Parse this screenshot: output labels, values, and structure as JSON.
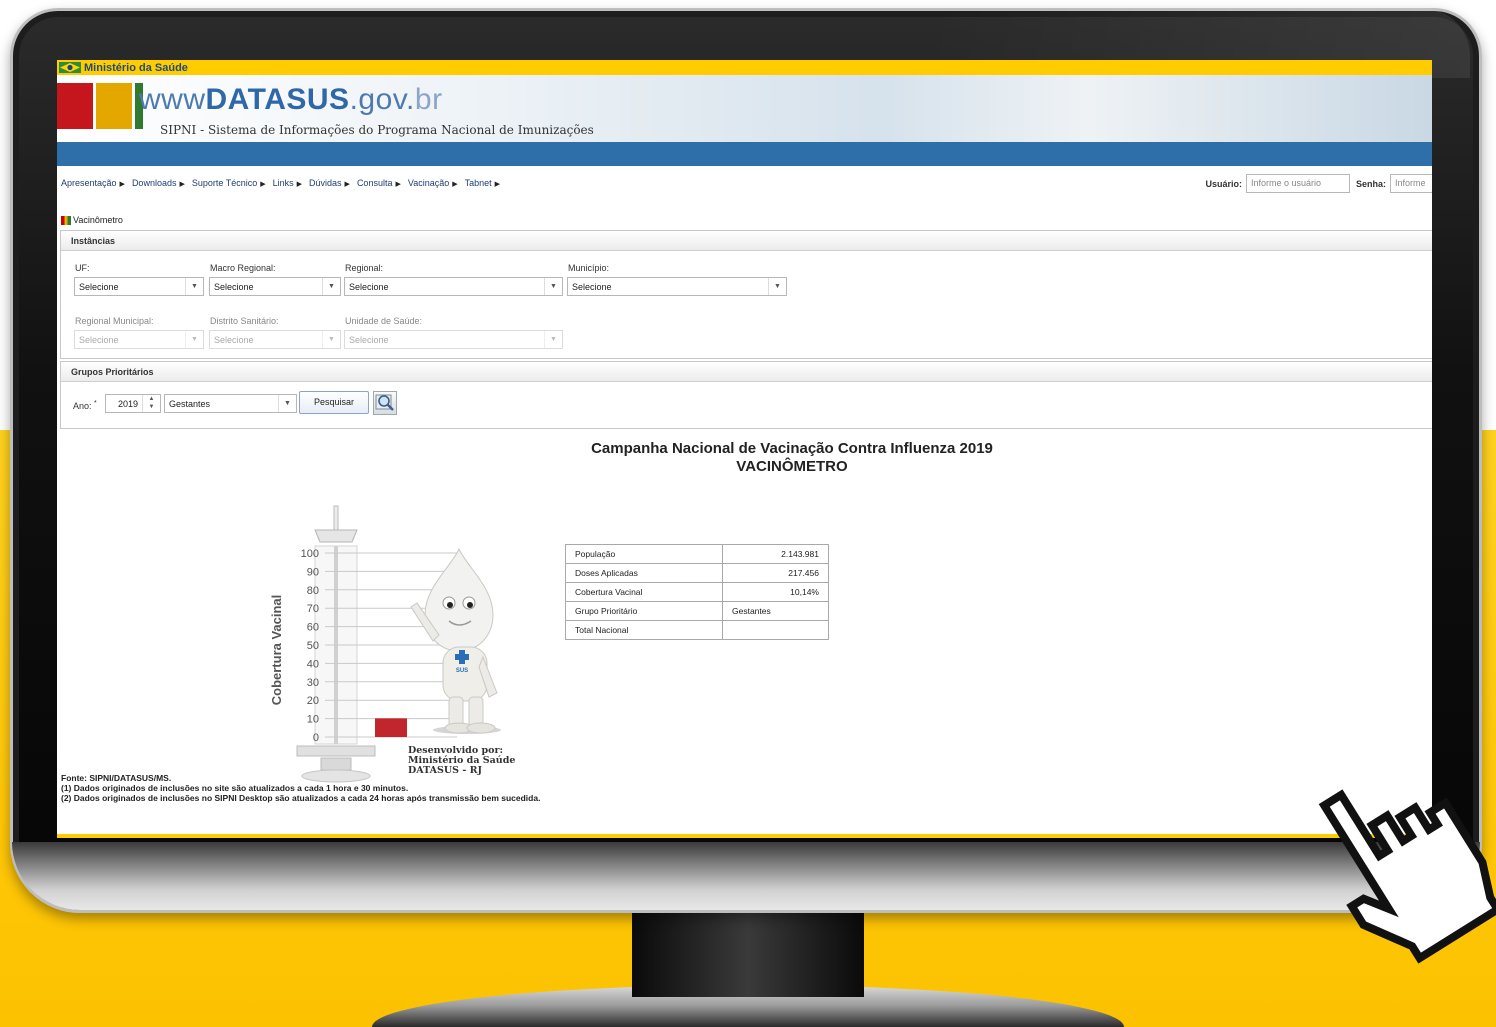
{
  "top_bar": {
    "ministry": "Ministério da Saúde"
  },
  "banner": {
    "site_prefix": "ww",
    "site_w": "w",
    "site_name": "DATASUS",
    "site_suffix": ".gov.",
    "site_tld": "br",
    "subtitle": "SIPNI - Sistema de Informações do Programa Nacional de Imunizações"
  },
  "nav": {
    "items": [
      {
        "label": "Apresentação"
      },
      {
        "label": "Downloads"
      },
      {
        "label": "Suporte Técnico"
      },
      {
        "label": "Links"
      },
      {
        "label": "Dúvidas"
      },
      {
        "label": "Consulta"
      },
      {
        "label": "Vacinação"
      },
      {
        "label": "Tabnet"
      }
    ],
    "arrow": "▶"
  },
  "login": {
    "user_label": "Usuário:",
    "user_placeholder": "Informe o usuário",
    "pass_label": "Senha:",
    "pass_placeholder": "Informe"
  },
  "breadcrumb": {
    "label": "Vacinômetro"
  },
  "instancias": {
    "heading": "Instâncias",
    "fields": [
      {
        "label": "UF:",
        "value": "Selecione",
        "enabled": true
      },
      {
        "label": "Macro Regional:",
        "value": "Selecione",
        "enabled": true
      },
      {
        "label": "Regional:",
        "value": "Selecione",
        "enabled": true
      },
      {
        "label": "Município:",
        "value": "Selecione",
        "enabled": true
      },
      {
        "label": "Regional Municipal:",
        "value": "Selecione",
        "enabled": false
      },
      {
        "label": "Distrito Sanitário:",
        "value": "Selecione",
        "enabled": false
      },
      {
        "label": "Unidade de Saúde:",
        "value": "Selecione",
        "enabled": false
      }
    ]
  },
  "grupos": {
    "heading": "Grupos Prioritários",
    "ano_label": "Ano:",
    "required_mark": "*",
    "ano_value": "2019",
    "grupo_value": "Gestantes",
    "search_label": "Pesquisar"
  },
  "report": {
    "title": "Campanha Nacional de Vacinação Contra Influenza 2019",
    "subtitle": "VACINÔMETRO",
    "rows": [
      {
        "label": "População",
        "value": "2.143.981",
        "align": "right"
      },
      {
        "label": "Doses Aplicadas",
        "value": "217.456",
        "align": "right"
      },
      {
        "label": "Cobertura Vacinal",
        "value": "10,14%",
        "align": "right"
      },
      {
        "label": "Grupo Prioritário",
        "value": "Gestantes",
        "align": "left"
      },
      {
        "label": "Total Nacional",
        "value": "",
        "align": "left"
      }
    ]
  },
  "chart_data": {
    "type": "bar",
    "ylabel": "Cobertura Vacinal",
    "ylim": [
      0,
      100
    ],
    "yticks": [
      "0",
      "10",
      "20",
      "30",
      "40",
      "50",
      "60",
      "70",
      "80",
      "90",
      "100"
    ],
    "values": [
      10.14
    ],
    "color": "#c0262b"
  },
  "mascot": {
    "badge": "SUS"
  },
  "developer": {
    "line1": "Desenvolvido por:",
    "line2": "Ministério da Saúde",
    "line3": "DATASUS - RJ"
  },
  "footnotes": {
    "source": "Fonte: SIPNI/DATASUS/MS.",
    "note1": "(1) Dados originados de inclusões no site são atualizados a cada 1 hora e 30 minutos.",
    "note2": "(2) Dados originados de inclusões no SIPNI Desktop são atualizados a cada 24 horas após transmissão bem sucedida."
  },
  "colors": {
    "yellow": "#ffcc00",
    "datasus_blue": "#2e6fa9",
    "bar_red": "#c0262b"
  }
}
